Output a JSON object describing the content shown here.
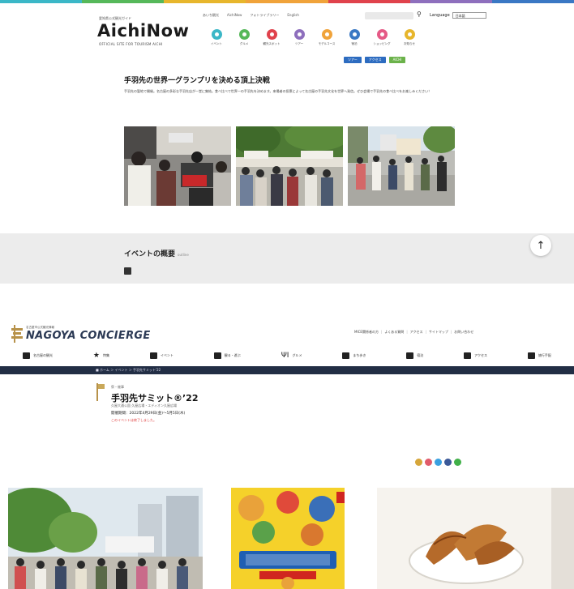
{
  "aichi": {
    "logo_pre": "愛知県公式観光ガイド",
    "logo_main": "AichiNow",
    "logo_sub": "OFFICIAL SITE FOR TOURISM AICHI",
    "top_links": [
      "あいち観光",
      "AichiNow",
      "フォトライブラリー",
      "English"
    ],
    "language_label": "Language",
    "language_value": "日本語",
    "nav": [
      {
        "label": "イベント",
        "color": "#3bb7c7"
      },
      {
        "label": "グルメ",
        "color": "#56b85a"
      },
      {
        "label": "観光スポット",
        "color": "#e0424c"
      },
      {
        "label": "ツアー",
        "color": "#8e6fbd"
      },
      {
        "label": "モデルコース",
        "color": "#f0a33a"
      },
      {
        "label": "宿泊",
        "color": "#3a78c4"
      },
      {
        "label": "ショッピング",
        "color": "#e55a86"
      },
      {
        "label": "お知らせ",
        "color": "#e7b62c"
      }
    ],
    "badges": [
      {
        "label": "ツアー",
        "color": "#2d6cc0"
      },
      {
        "label": "アクセス",
        "color": "#2d6cc0"
      },
      {
        "label": "AICHI",
        "color": "#6bb24a"
      }
    ],
    "title": "手羽先の世界一グランプリを決める頂上決戦",
    "desc": "手羽先の聖地で開催。名古屋の多彩な手羽先店が一堂に集結。食べ比べで世界一の手羽先を決めます。来場者の投票によって名古屋の手羽先文化を世界へ発信。ぜひ会場で手羽先の食べ比べをお楽しみください！",
    "overview": "イベントの概要",
    "overview_en": "outline",
    "back_to_top": "↑"
  },
  "nagoya": {
    "logo_pre": "名古屋市公式観光情報",
    "logo_name": "NAGOYA CONCIERGE",
    "top_links": [
      "MICE関係者の方",
      "よくある質問",
      "アクセス",
      "サイトマップ",
      "お問い合わせ"
    ],
    "nav": [
      "名古屋の観光",
      "特集",
      "イベント",
      "観る・遊ぶ",
      "グルメ",
      "まち歩き",
      "宿泊",
      "アクセス",
      "旅行手配"
    ],
    "breadcrumb": "■ ホーム ＞ イベント ＞ 手羽先サミット'22",
    "category": "祭・催事",
    "title": "手羽先サミット®’22",
    "subtitle": "久屋大通公園 久屋広場・エディオン久屋広場",
    "date": "開催期間：2022年4月29日(金)〜5月5日(木)",
    "ended": "このイベントは終了しました。",
    "share_colors": [
      "#d6a63a",
      "#e15b6b",
      "#3aa0e0",
      "#3b5998",
      "#41b049"
    ]
  }
}
